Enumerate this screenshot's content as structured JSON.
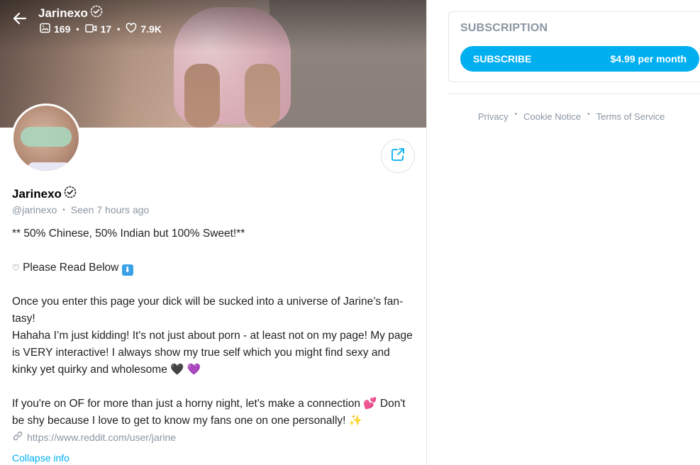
{
  "cover": {
    "title": "Jarinexo",
    "stats": {
      "photos": "169",
      "videos": "17",
      "likes": "7.9K"
    }
  },
  "profile": {
    "name": "Jarinexo",
    "handle": "@jarinexo",
    "seen": "Seen  7 hours ago",
    "bio": {
      "line1": "** 50% Chinese, 50% Indian but 100% Sweet!**",
      "line2_heart": "♡",
      "line2_text": " Please Read Below ",
      "line2_emoji": "⬇",
      "line3": "Once you enter this page your dick will be sucked into a universe of Jarine’s fan-tasy!",
      "line4": "Hahaha I’m just kidding! It's not just about porn - at least not on my page! My page is VERY interactive! I always show my true self which you might find sexy and kinky yet quirky and wholesome ",
      "line4_emoji1": "🖤",
      "line4_emoji2": "💜",
      "line5": "If you're on OF for more than just a horny night, let's make a connection ",
      "line5_emoji": "💕",
      "line5_rest": " Don't be shy because I love to get to know my fans one on one personally! ",
      "line5_emoji2": "✨"
    },
    "link": "https://www.reddit.com/user/jarine",
    "collapse": "Collapse info"
  },
  "subscription": {
    "title": "SUBSCRIPTION",
    "button_label": "SUBSCRIBE",
    "price": "$4.99 per month"
  },
  "footer": {
    "privacy": "Privacy",
    "cookie": "Cookie Notice",
    "terms": "Terms of Service"
  },
  "colors": {
    "accent": "#00aff0",
    "muted": "#8a96a3"
  },
  "icons": [
    "back-arrow-icon",
    "verified-badge-icon",
    "image-icon",
    "video-icon",
    "heart-icon",
    "share-icon",
    "link-icon"
  ]
}
